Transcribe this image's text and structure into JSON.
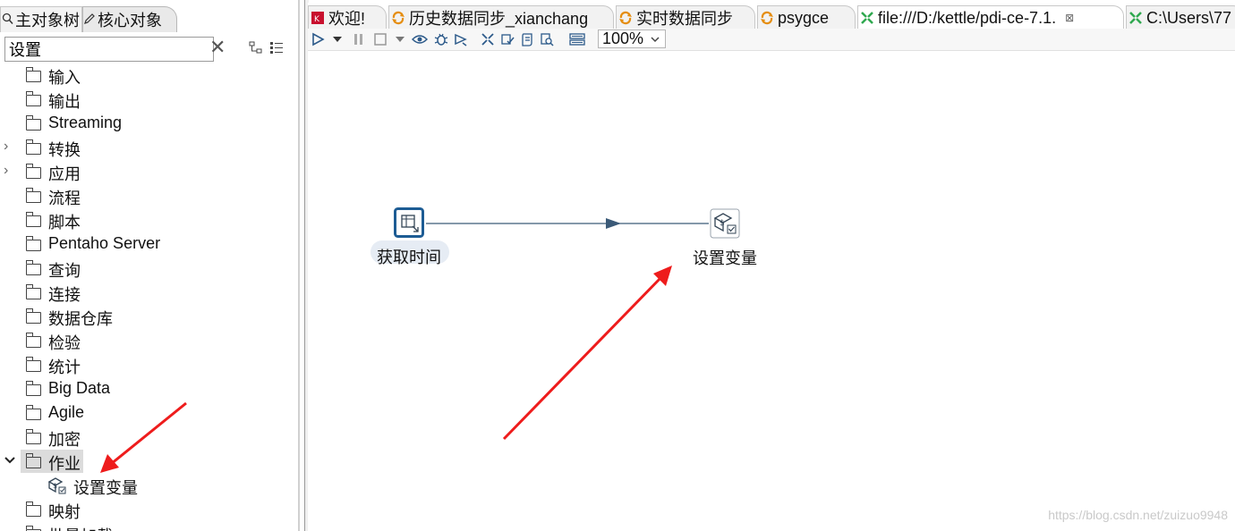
{
  "left_panel": {
    "tabs": [
      {
        "label": "主对象树"
      },
      {
        "label": "核心对象"
      }
    ],
    "search": {
      "value": "设置",
      "placeholder": ""
    },
    "tree": [
      {
        "label": "输入",
        "expandable": false
      },
      {
        "label": "输出",
        "expandable": false
      },
      {
        "label": "Streaming",
        "expandable": false
      },
      {
        "label": "转换",
        "expandable": true
      },
      {
        "label": "应用",
        "expandable": true
      },
      {
        "label": "流程",
        "expandable": false
      },
      {
        "label": "脚本",
        "expandable": false
      },
      {
        "label": "Pentaho Server",
        "expandable": false
      },
      {
        "label": "查询",
        "expandable": false
      },
      {
        "label": "连接",
        "expandable": false
      },
      {
        "label": "数据仓库",
        "expandable": false
      },
      {
        "label": "检验",
        "expandable": false
      },
      {
        "label": "统计",
        "expandable": false
      },
      {
        "label": "Big Data",
        "expandable": false
      },
      {
        "label": "Agile",
        "expandable": false
      },
      {
        "label": "加密",
        "expandable": false
      },
      {
        "label": "作业",
        "expandable": true,
        "expanded": true,
        "selected": true
      },
      {
        "label": "设置变量",
        "child": true
      },
      {
        "label": "映射",
        "expandable": false
      },
      {
        "label": "批量加载",
        "expandable": false
      }
    ]
  },
  "editor": {
    "tabs": [
      {
        "label": "欢迎!",
        "icon": "welcome-icon"
      },
      {
        "label": "历史数据同步_xianchang",
        "icon": "transformation-icon"
      },
      {
        "label": "实时数据同步",
        "icon": "transformation-icon"
      },
      {
        "label": "psygce",
        "icon": "transformation-icon"
      },
      {
        "label": "file:///D:/kettle/pdi-ce-7.1.",
        "icon": "job-icon",
        "active": true,
        "close": "⊠"
      },
      {
        "label": "C:\\Users\\77",
        "icon": "job-icon"
      }
    ],
    "toolbar": {
      "zoom": "100%"
    },
    "canvas": {
      "steps": [
        {
          "label": "获取时间",
          "icon": "get-system-info-icon"
        },
        {
          "label": "设置变量",
          "icon": "set-variables-icon"
        }
      ]
    },
    "watermark": "https://blog.csdn.net/zuizuo9948"
  },
  "colors": {
    "hop_line": "#3b5a78",
    "annotation_arrow": "#ee1c1c",
    "step_border": "#1d5c94",
    "tab_icon_orange": "#e58e12",
    "tab_icon_green": "#2fa84f",
    "welcome_red": "#c8102e"
  }
}
